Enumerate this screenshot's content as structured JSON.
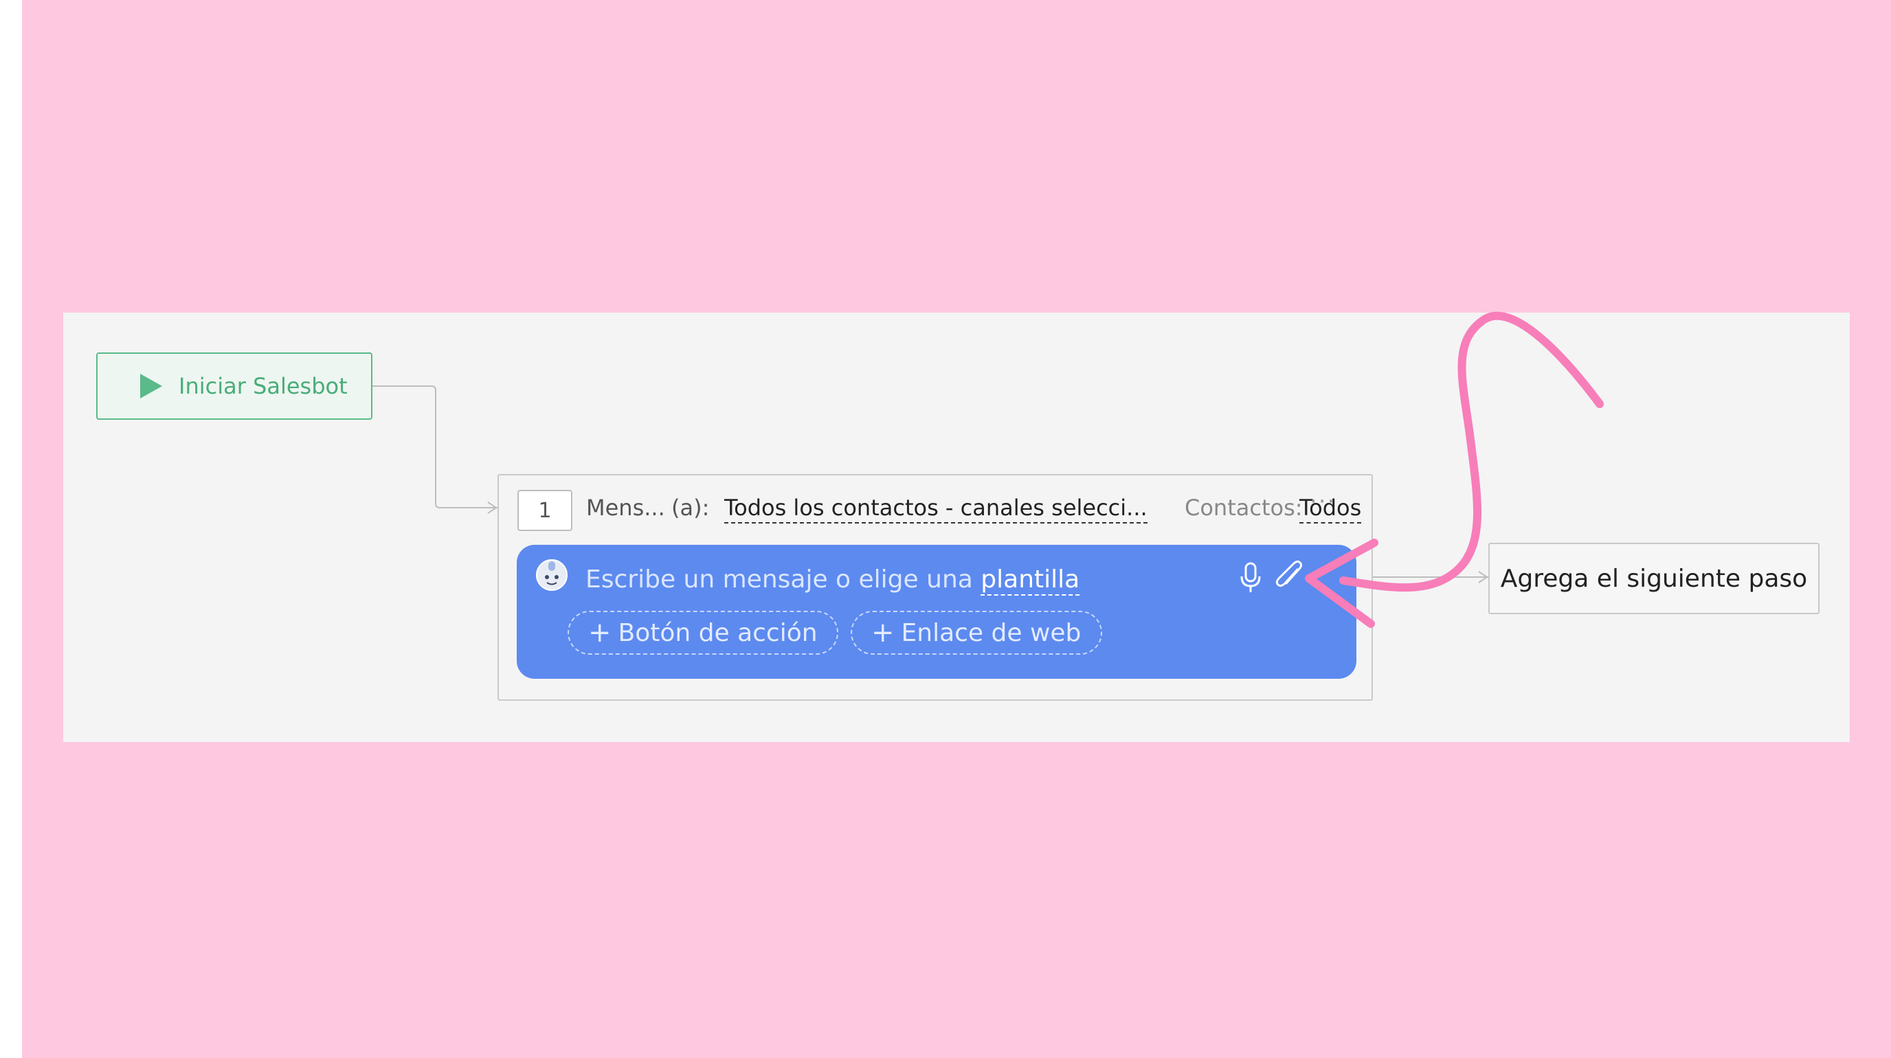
{
  "start_node": {
    "label": "Iniciar Salesbot",
    "icon": "play-icon"
  },
  "step": {
    "number": "1",
    "type_label": "Mens...",
    "recipient_prefix": "(a):",
    "recipient_value": "Todos los contactos - canales selecci...",
    "contacts_label": "Contactos:",
    "contacts_value": "Todos",
    "more_label": "···",
    "message": {
      "placeholder": "Escribe un mensaje o elige una",
      "template_link": "plantilla",
      "avatar_icon": "bot-avatar-icon",
      "mic_icon": "microphone-icon",
      "attach_icon": "paperclip-icon"
    },
    "chips": [
      {
        "plus": "+",
        "label": "Botón de acción"
      },
      {
        "plus": "+",
        "label": "Enlace de web"
      }
    ]
  },
  "next_step": {
    "label": "Agrega el siguiente paso"
  },
  "colors": {
    "background": "#fec8e0",
    "canvas": "#f4f4f4",
    "start_green": "#49ad79",
    "message_blue": "#5c8aef",
    "annotation_pink": "#f77eb9"
  }
}
